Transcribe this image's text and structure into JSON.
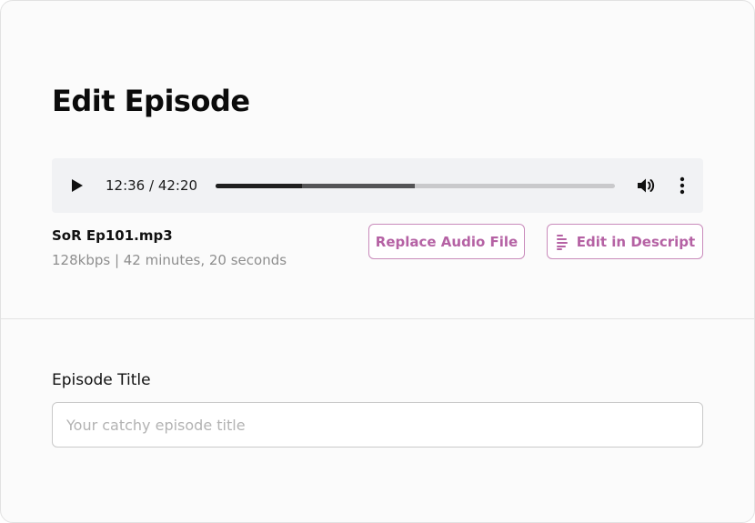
{
  "page": {
    "title": "Edit Episode"
  },
  "player": {
    "time_display": "12:36 / 42:20",
    "played_fraction": 0.216,
    "buffered_fraction": 0.498,
    "icons": {
      "play": "play-icon",
      "volume": "volume-icon",
      "more": "more-vertical-icon"
    }
  },
  "file": {
    "name": "SoR Ep101.mp3",
    "details": "128kbps | 42 minutes, 20 seconds"
  },
  "actions": {
    "replace_label": "Replace Audio File",
    "descript_label": "Edit in Descript",
    "descript_icon": "descript-logo-icon"
  },
  "episode_title": {
    "label": "Episode Title",
    "placeholder": "Your catchy episode title",
    "value": ""
  },
  "colors": {
    "accent": "#b562a4",
    "accent_border": "#c98bbb",
    "player_bg": "#f1f2f4"
  }
}
